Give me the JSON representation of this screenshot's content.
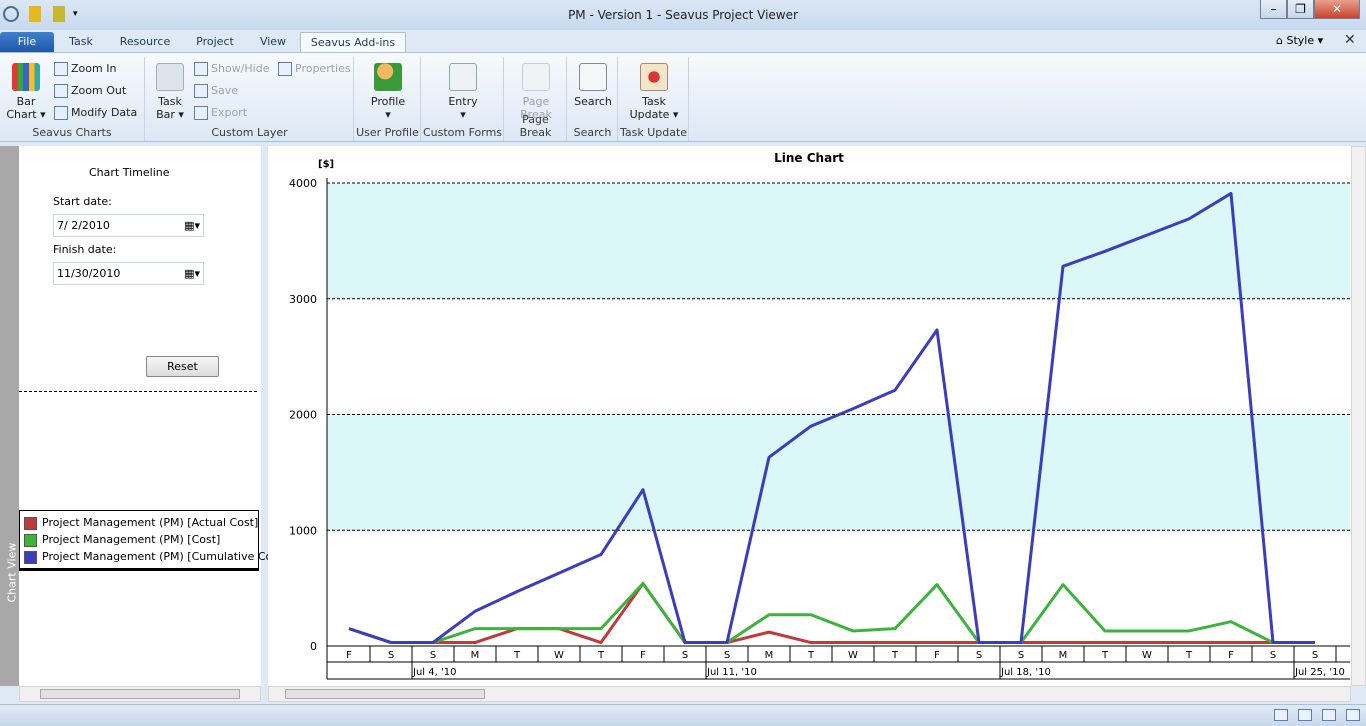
{
  "window": {
    "title": "PM - Version 1 - Seavus Project Viewer",
    "minimize": "–",
    "maximize": "❐",
    "close": "✕"
  },
  "tabs": [
    {
      "label": "File"
    },
    {
      "label": "Task"
    },
    {
      "label": "Resource"
    },
    {
      "label": "Project"
    },
    {
      "label": "View"
    },
    {
      "label": "Seavus Add-ins"
    }
  ],
  "style_menu": "Style",
  "ribbon": {
    "seavus_charts": {
      "label": "Seavus Charts",
      "bar_chart": "Bar Chart",
      "zoom_in": "Zoom In",
      "zoom_out": "Zoom Out",
      "modify_data": "Modify Data"
    },
    "custom_layer": {
      "label": "Custom Layer",
      "task_bar": "Task Bar",
      "show_hide": "Show/Hide",
      "properties": "Properties",
      "save": "Save",
      "export": "Export"
    },
    "user_profile": {
      "label": "User Profile",
      "profile": "Profile"
    },
    "custom_forms": {
      "label": "Custom Forms",
      "entry": "Entry"
    },
    "page_break": {
      "label": "Page Break",
      "page_break": "Page Break"
    },
    "search": {
      "label": "Search",
      "search": "Search"
    },
    "task_update": {
      "label": "Task Update",
      "task_update": "Task Update"
    }
  },
  "side": {
    "vertical_label": "Chart View",
    "timeline_title": "Chart Timeline",
    "start_label": "Start date:",
    "start_value": "7/  2/2010",
    "finish_label": "Finish date:",
    "finish_value": "11/30/2010",
    "reset": "Reset"
  },
  "legend": [
    {
      "name": "Project Management (PM) [Actual Cost]",
      "color": "#c0393b"
    },
    {
      "name": "Project Management (PM) [Cost]",
      "color": "#3cb43c"
    },
    {
      "name": "Project Management (PM) [Cumulative Cost]",
      "color": "#3c3cbe"
    }
  ],
  "chart_data": {
    "type": "line",
    "title": "Line Chart",
    "ylabel": "[$]",
    "ylim": [
      0,
      4000
    ],
    "yticks": [
      0,
      1000,
      2000,
      3000,
      4000
    ],
    "grid": true,
    "shaded_bands": [
      [
        1000,
        2000
      ],
      [
        3000,
        4000
      ]
    ],
    "band_color": "#dcf7f7",
    "day_labels": [
      "F",
      "S",
      "S",
      "M",
      "T",
      "W",
      "T",
      "F",
      "S",
      "S",
      "M",
      "T",
      "W",
      "T",
      "F",
      "S",
      "S",
      "M",
      "T",
      "W",
      "T",
      "F",
      "S",
      "S"
    ],
    "week_labels": [
      {
        "label": "Jul 4, '10",
        "day_index": 2
      },
      {
        "label": "Jul 11, '10",
        "day_index": 9
      },
      {
        "label": "Jul 18, '10",
        "day_index": 16
      },
      {
        "label": "Jul 25, '10",
        "day_index": 23
      }
    ],
    "series": [
      {
        "name": "Project Management (PM) [Actual Cost]",
        "color": "#c0393b",
        "values": [
          150,
          30,
          30,
          30,
          150,
          150,
          30,
          540,
          30,
          30,
          120,
          30,
          30,
          30,
          30,
          30,
          30,
          30,
          30,
          30,
          30,
          30,
          30,
          30
        ]
      },
      {
        "name": "Project Management (PM) [Cost]",
        "color": "#3cb43c",
        "values": [
          150,
          30,
          30,
          150,
          150,
          150,
          150,
          540,
          30,
          30,
          270,
          270,
          130,
          150,
          530,
          30,
          30,
          530,
          130,
          130,
          130,
          210,
          30,
          30
        ]
      },
      {
        "name": "Project Management (PM) [Cumulative Cost]",
        "color": "#3c3cbe",
        "values": [
          150,
          30,
          30,
          300,
          470,
          630,
          790,
          1350,
          30,
          30,
          1630,
          1900,
          2050,
          2210,
          2730,
          30,
          30,
          3280,
          3410,
          3550,
          3690,
          3910,
          30,
          30
        ]
      }
    ]
  }
}
